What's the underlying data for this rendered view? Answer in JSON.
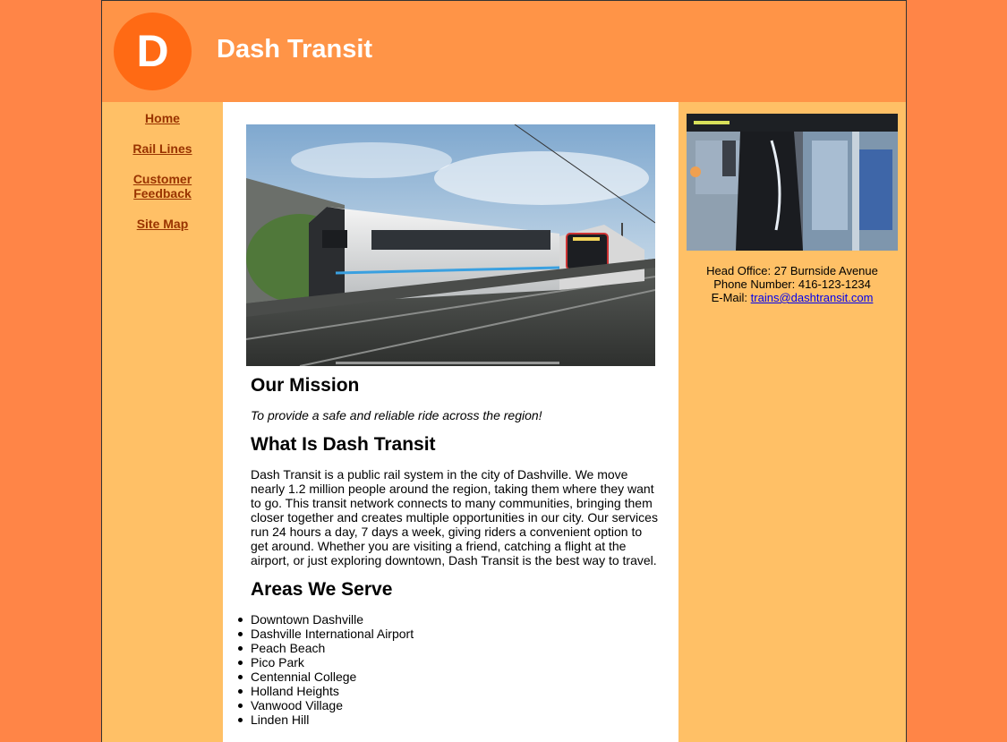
{
  "header": {
    "logo_letter": "D",
    "title": "Dash Transit"
  },
  "nav": [
    {
      "label": "Home"
    },
    {
      "label": "Rail Lines"
    },
    {
      "label": "Customer Feedback"
    },
    {
      "label": "Site Map"
    }
  ],
  "main": {
    "mission_heading": "Our Mission",
    "mission_text": "To provide a safe and reliable ride across the region!",
    "about_heading": "What Is Dash Transit",
    "about_text": "Dash Transit is a public rail system in the city of Dashville. We move nearly 1.2 million people around the region, taking them where they want to go. This transit network connects to many communities, bringing them closer together and creates multiple opportunities in our city. Our services run 24 hours a day, 7 days a week, giving riders a convenient option to get around. Whether you are visiting a friend, catching a flight at the airport, or just exploring downtown, Dash Transit is the best way to travel.",
    "areas_heading": "Areas We Serve",
    "areas": [
      "Downtown Dashville",
      "Dashville International Airport",
      "Peach Beach",
      "Pico Park",
      "Centennial College",
      "Holland Heights",
      "Vanwood Village",
      "Linden Hill"
    ]
  },
  "sidebar": {
    "office": "Head Office: 27 Burnside Avenue",
    "phone": "Phone Number: 416-123-1234",
    "email_label": "E-Mail: ",
    "email": "trains@dashtransit.com"
  },
  "colors": {
    "outer_bg": "#ff8547",
    "header_bg": "#ff9447",
    "logo_circle": "#ff6a14",
    "column_bg": "#ffc066",
    "nav_link": "#993300"
  }
}
